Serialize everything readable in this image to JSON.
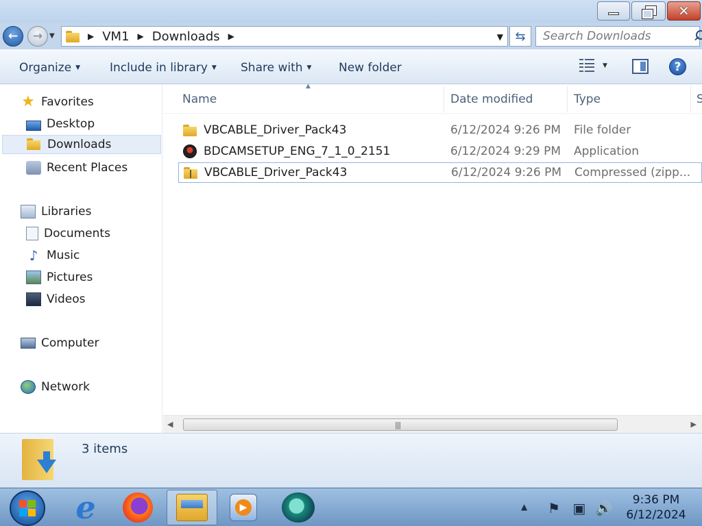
{
  "window": {
    "minimize": "minimize",
    "maximize": "restore",
    "close": "close"
  },
  "address": {
    "breadcrumbs": [
      "VM1",
      "Downloads"
    ],
    "search_placeholder": "Search Downloads"
  },
  "toolbar": {
    "organize": "Organize",
    "include_in_library": "Include in library",
    "share_with": "Share with",
    "new_folder": "New folder"
  },
  "navigation": {
    "favorites": {
      "label": "Favorites",
      "items": [
        {
          "label": "Desktop",
          "icon": "desktop-icon"
        },
        {
          "label": "Downloads",
          "icon": "downloads-folder-icon",
          "selected": true
        },
        {
          "label": "Recent Places",
          "icon": "recent-places-icon"
        }
      ]
    },
    "libraries": {
      "label": "Libraries",
      "items": [
        {
          "label": "Documents",
          "icon": "documents-icon"
        },
        {
          "label": "Music",
          "icon": "music-icon"
        },
        {
          "label": "Pictures",
          "icon": "pictures-icon"
        },
        {
          "label": "Videos",
          "icon": "videos-icon"
        }
      ]
    },
    "computer": "Computer",
    "network": "Network"
  },
  "columns": {
    "name": "Name",
    "date_modified": "Date modified",
    "type": "Type",
    "size": "S"
  },
  "files": [
    {
      "name": "VBCABLE_Driver_Pack43",
      "date": "6/12/2024 9:26 PM",
      "type": "File folder",
      "icon": "folder-icon"
    },
    {
      "name": "BDCAMSETUP_ENG_7_1_0_2151",
      "date": "6/12/2024 9:29 PM",
      "type": "Application",
      "icon": "application-icon"
    },
    {
      "name": "VBCABLE_Driver_Pack43",
      "date": "6/12/2024 9:26 PM",
      "type": "Compressed (zipp...",
      "icon": "zip-folder-icon"
    }
  ],
  "details": {
    "item_count": "3 items"
  },
  "taskbar": {
    "apps": [
      "Internet Explorer",
      "Firefox",
      "Windows Explorer",
      "Windows Media Player",
      "Bandicam"
    ],
    "clock_time": "9:36 PM",
    "clock_date": "6/12/2024"
  },
  "colors": {
    "accent": "#1f5aa6",
    "titlebar": "#bcd3ec",
    "close": "#c2412a",
    "selection": "#e4edf8"
  }
}
